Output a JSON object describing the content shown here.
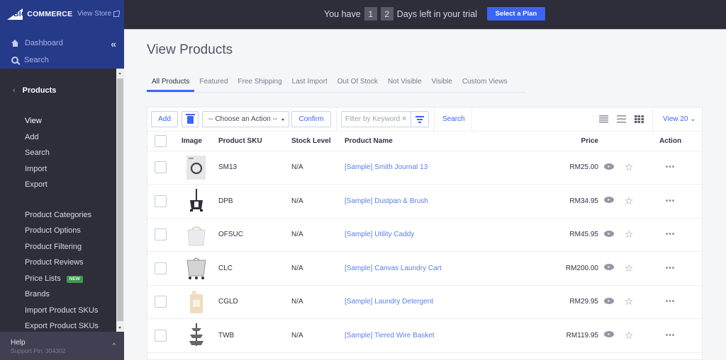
{
  "brand": {
    "logo_big": "BIG",
    "logo_rest": "COMMERCE",
    "view_store": "View Store"
  },
  "nav": {
    "dashboard": "Dashboard",
    "search": "Search",
    "section_title": "Products",
    "items": [
      {
        "label": "View",
        "active": true
      },
      {
        "label": "Add"
      },
      {
        "label": "Search"
      },
      {
        "label": "Import"
      },
      {
        "label": "Export"
      }
    ],
    "items2": [
      {
        "label": "Product Categories"
      },
      {
        "label": "Product Options"
      },
      {
        "label": "Product Filtering"
      },
      {
        "label": "Product Reviews"
      },
      {
        "label": "Price Lists",
        "badge": "NEW"
      },
      {
        "label": "Brands"
      },
      {
        "label": "Import Product SKUs"
      },
      {
        "label": "Export Product SKUs"
      }
    ],
    "help": {
      "title": "Help",
      "pin": "Support Pin: 304302"
    }
  },
  "trial": {
    "prefix": "You have",
    "digit1": "1",
    "digit2": "2",
    "suffix": "Days left in your trial",
    "cta": "Select a Plan"
  },
  "page": {
    "title": "View Products",
    "tabs": [
      "All Products",
      "Featured",
      "Free Shipping",
      "Last Import",
      "Out Of Stock",
      "Not Visible",
      "Visible",
      "Custom Views"
    ],
    "active_tab": "All Products"
  },
  "toolbar": {
    "add": "Add",
    "action_select": "-- Choose an Action --",
    "confirm": "Confirm",
    "filter_placeholder": "Filter by Keyword",
    "search": "Search",
    "view_count": "View 20"
  },
  "table": {
    "headers": {
      "image": "Image",
      "sku": "Product SKU",
      "stock": "Stock Level",
      "name": "Product Name",
      "price": "Price",
      "action": "Action"
    },
    "rows": [
      {
        "sku": "SM13",
        "stock": "N/A",
        "name": "[Sample] Smith Journal 13",
        "price": "RM25.00",
        "thumb": "journal"
      },
      {
        "sku": "DPB",
        "stock": "N/A",
        "name": "[Sample] Dustpan & Brush",
        "price": "RM34.95",
        "thumb": "dustpan"
      },
      {
        "sku": "OFSUC",
        "stock": "N/A",
        "name": "[Sample] Utility Caddy",
        "price": "RM45.95",
        "thumb": "caddy"
      },
      {
        "sku": "CLC",
        "stock": "N/A",
        "name": "[Sample] Canvas Laundry Cart",
        "price": "RM200.00",
        "thumb": "cart"
      },
      {
        "sku": "CGLD",
        "stock": "N/A",
        "name": "[Sample] Laundry Detergent",
        "price": "RM29.95",
        "thumb": "detergent"
      },
      {
        "sku": "TWB",
        "stock": "N/A",
        "name": "[Sample] Tiered Wire Basket",
        "price": "RM119.95",
        "thumb": "basket"
      }
    ]
  },
  "colors": {
    "accent": "#3c64f4",
    "sidebar": "#2e2d3a",
    "sidebar_top": "#263a8a",
    "link": "#5b7fe8",
    "badge_new": "#3d9c4a"
  }
}
